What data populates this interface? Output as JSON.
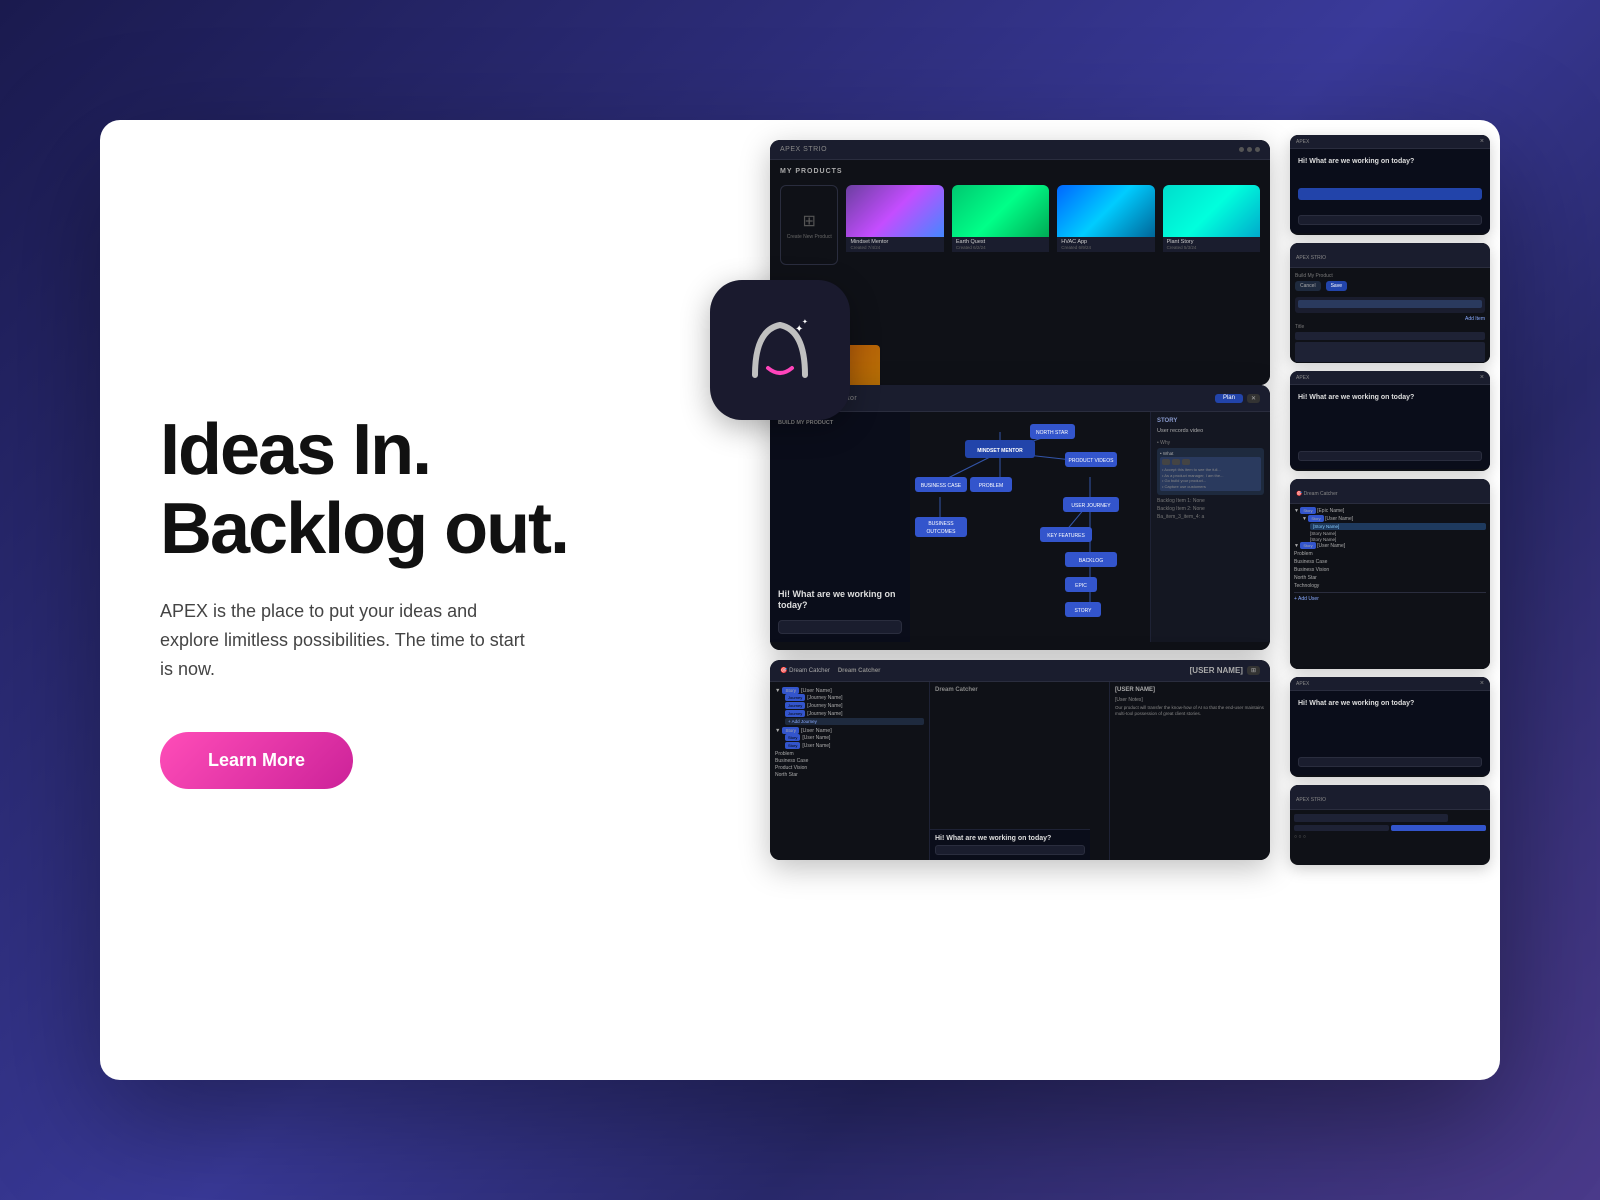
{
  "background": {
    "gradient": "linear-gradient(135deg, #1a1a4e 0%, #2d2d7a 30%, #3a3a9a 50%, #2a2a6e 70%, #4a3a8a 100%)"
  },
  "hero": {
    "title_line1": "Ideas In.",
    "title_line2": "Backlog out.",
    "subtitle": "APEX is the place to put your ideas and explore limitless possibilities. The time to start is now.",
    "cta_label": "Learn More"
  },
  "app": {
    "name": "APEX",
    "tagline": "APEX STRIO"
  },
  "screenshots": {
    "top": {
      "title": "MY PRODUCTS",
      "products": [
        {
          "name": "Mindset Mentor",
          "sub": "Created 7/4/24",
          "gradient": "thumb-1"
        },
        {
          "name": "Earth Quest",
          "sub": "Created 6/2/24",
          "gradient": "thumb-2"
        },
        {
          "name": "HVAC App",
          "sub": "Created 6/9/24",
          "gradient": "thumb-3"
        },
        {
          "name": "Plant Story",
          "sub": "Created 5/3/24",
          "gradient": "thumb-4"
        }
      ],
      "create_label": "Create New Product"
    },
    "middle": {
      "title": "Mindset Mentor",
      "chat_question": "Hi! What are we working on today?",
      "nodes": [
        "MINDSET MENTOR",
        "BUSINESS CASE",
        "PROBLEM",
        "NORTH STAR",
        "PRODUCT VIDEOS",
        "BUSINESS OUTCOMES",
        "USER JOURNEY",
        "KEY FEATURES",
        "BACKLOG",
        "EPIC",
        "STORY"
      ],
      "story_section": {
        "title": "STORY",
        "label": "User records video",
        "items": [
          "Why",
          "What"
        ]
      }
    },
    "bottom": {
      "title": "Dream Catcher",
      "columns": [
        "[USER NAME]",
        "[User Notes]"
      ],
      "rows": [
        {
          "label": "Story",
          "items": [
            "[Journey Name]",
            "[Journey Name]",
            "[Journey Name]"
          ]
        },
        {
          "label": "Story",
          "items": [
            "[User Name]",
            "[User Name]"
          ]
        },
        {
          "labels": [
            "Problem",
            "Business Case",
            "Product Vision",
            "North Star"
          ]
        }
      ]
    }
  },
  "side_panels": {
    "panel1": {
      "chat_question": "Hi! What are we working on today?"
    },
    "panel2": {
      "type": "ui",
      "buttons": [
        "Cancel",
        "Save"
      ]
    },
    "panel3": {
      "chat_question": "Hi! What are we working on today?"
    },
    "panel4": {
      "type": "backlog",
      "items": [
        "Story",
        "Problem",
        "Business Case",
        "Business Vision",
        "North Star",
        "Technology"
      ],
      "sub_items": [
        "[Epic Name]",
        "[User Name]",
        "[Story Name]",
        "[Story Name]",
        "[Story Name]"
      ]
    },
    "panel5": {
      "chat_question": "Hi! What are we working on today?"
    },
    "panel6": {
      "type": "ui-small"
    }
  }
}
